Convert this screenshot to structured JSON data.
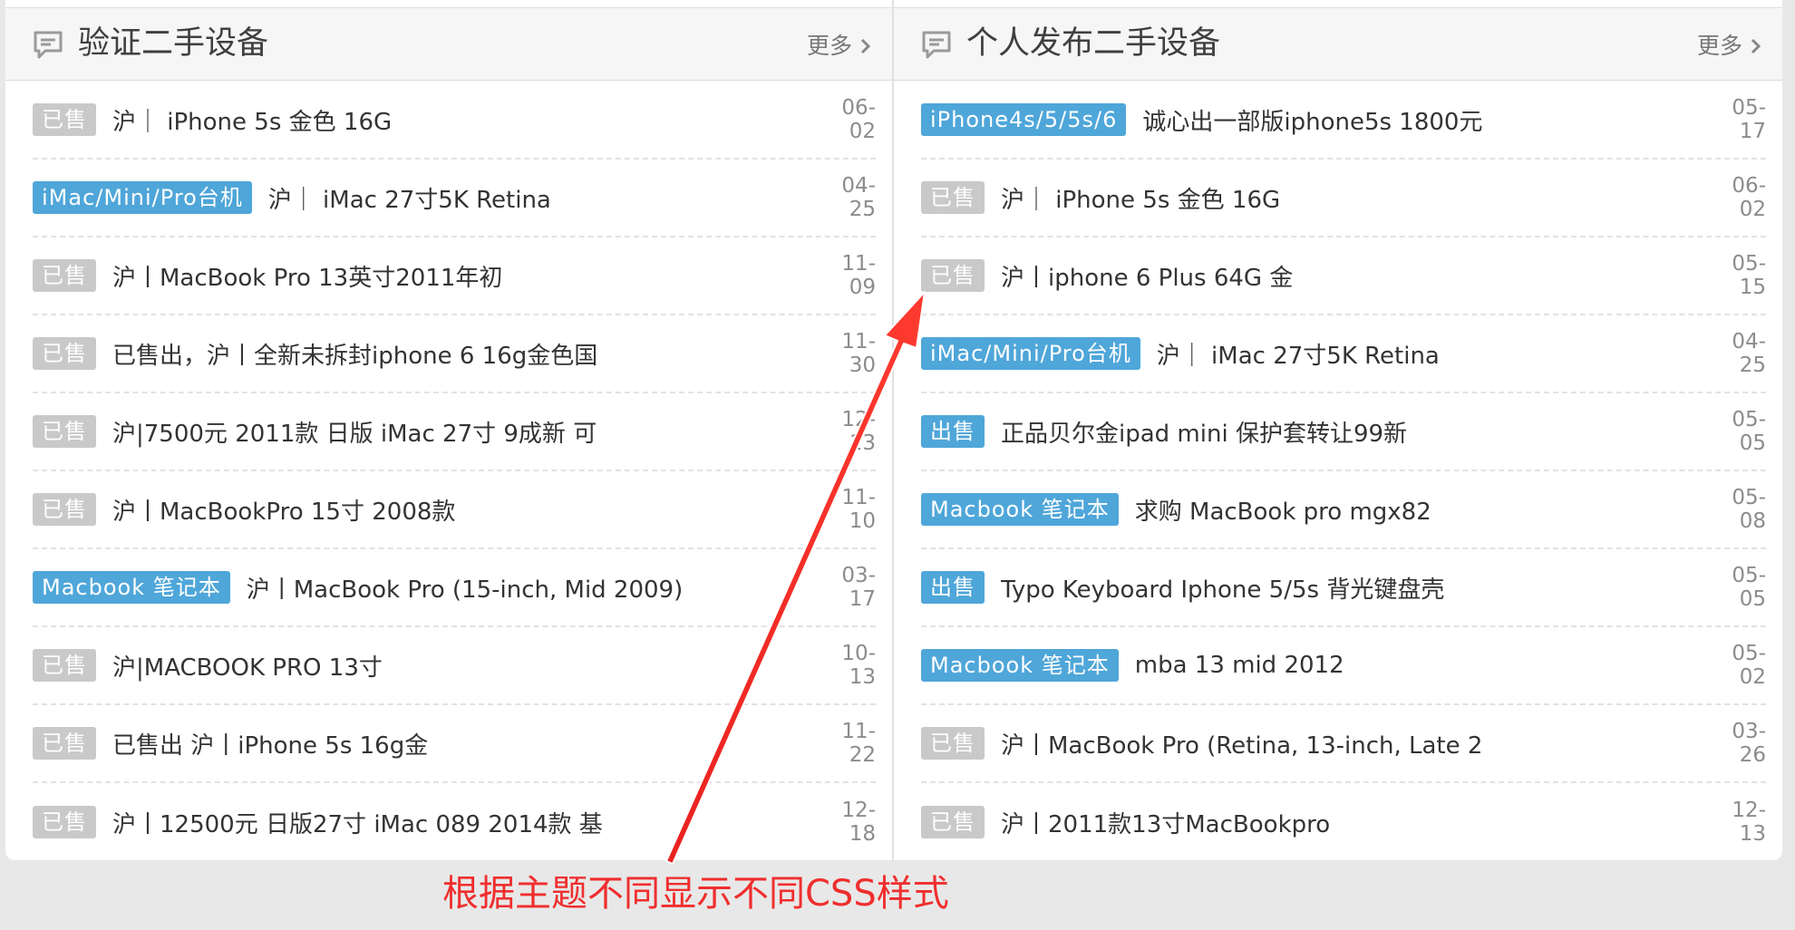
{
  "colors": {
    "sold_tag": "#c9c9c9",
    "category_tag": "#4fa6d9",
    "annotation": "#f02e2e"
  },
  "left_panel": {
    "icon": "comment-icon",
    "title": "验证二手设备",
    "more_label": "更多",
    "items": [
      {
        "tag": "已售",
        "tag_type": "sold",
        "title": "沪｜ iPhone 5s 金色 16G",
        "date": "06-02"
      },
      {
        "tag": "iMac/Mini/Pro台机",
        "tag_type": "category",
        "title": "沪｜ iMac 27寸5K Retina",
        "date": "04-25"
      },
      {
        "tag": "已售",
        "tag_type": "sold",
        "title": "沪丨MacBook Pro 13英寸2011年初",
        "date": "11-09"
      },
      {
        "tag": "已售",
        "tag_type": "sold",
        "title": "已售出，沪丨全新未拆封iphone 6 16g金色国",
        "date": "11-30"
      },
      {
        "tag": "已售",
        "tag_type": "sold",
        "title": "沪|7500元 2011款 日版 iMac 27寸 9成新 可",
        "date": "12-13"
      },
      {
        "tag": "已售",
        "tag_type": "sold",
        "title": "沪丨MacBookPro 15寸 2008款",
        "date": "11-10"
      },
      {
        "tag": "Macbook 笔记本",
        "tag_type": "category",
        "title": "沪丨MacBook Pro (15-inch, Mid 2009)",
        "date": "03-17"
      },
      {
        "tag": "已售",
        "tag_type": "sold",
        "title": "沪|MACBOOK PRO 13寸",
        "date": "10-13"
      },
      {
        "tag": "已售",
        "tag_type": "sold",
        "title": "已售出 沪丨iPhone 5s 16g金",
        "date": "11-22"
      },
      {
        "tag": "已售",
        "tag_type": "sold",
        "title": "沪丨12500元 日版27寸 iMac 089 2014款 基",
        "date": "12-18"
      }
    ]
  },
  "right_panel": {
    "icon": "comment-icon",
    "title": "个人发布二手设备",
    "more_label": "更多",
    "items": [
      {
        "tag": "iPhone4s/5/5s/6",
        "tag_type": "category",
        "title": "诚心出一部版iphone5s 1800元",
        "date": "05-17"
      },
      {
        "tag": "已售",
        "tag_type": "sold",
        "title": "沪｜ iPhone 5s 金色 16G",
        "date": "06-02"
      },
      {
        "tag": "已售",
        "tag_type": "sold",
        "title": "沪丨iphone 6 Plus 64G 金",
        "date": "05-15"
      },
      {
        "tag": "iMac/Mini/Pro台机",
        "tag_type": "category",
        "title": "沪｜ iMac 27寸5K Retina",
        "date": "04-25"
      },
      {
        "tag": "出售",
        "tag_type": "category",
        "title": "正品贝尔金ipad mini 保护套转让99新",
        "date": "05-05"
      },
      {
        "tag": "Macbook 笔记本",
        "tag_type": "category",
        "title": "求购 MacBook pro mgx82",
        "date": "05-08"
      },
      {
        "tag": "出售",
        "tag_type": "category",
        "title": "Typo Keyboard Iphone 5/5s 背光键盘壳",
        "date": "05-05"
      },
      {
        "tag": "Macbook 笔记本",
        "tag_type": "category",
        "title": "mba 13 mid 2012",
        "date": "05-02"
      },
      {
        "tag": "已售",
        "tag_type": "sold",
        "title": "沪丨MacBook Pro (Retina, 13-inch, Late 2",
        "date": "03-26"
      },
      {
        "tag": "已售",
        "tag_type": "sold",
        "title": "沪丨2011款13寸MacBookpro",
        "date": "12-13"
      }
    ]
  },
  "annotation": {
    "text": "根据主题不同显示不同CSS样式"
  }
}
